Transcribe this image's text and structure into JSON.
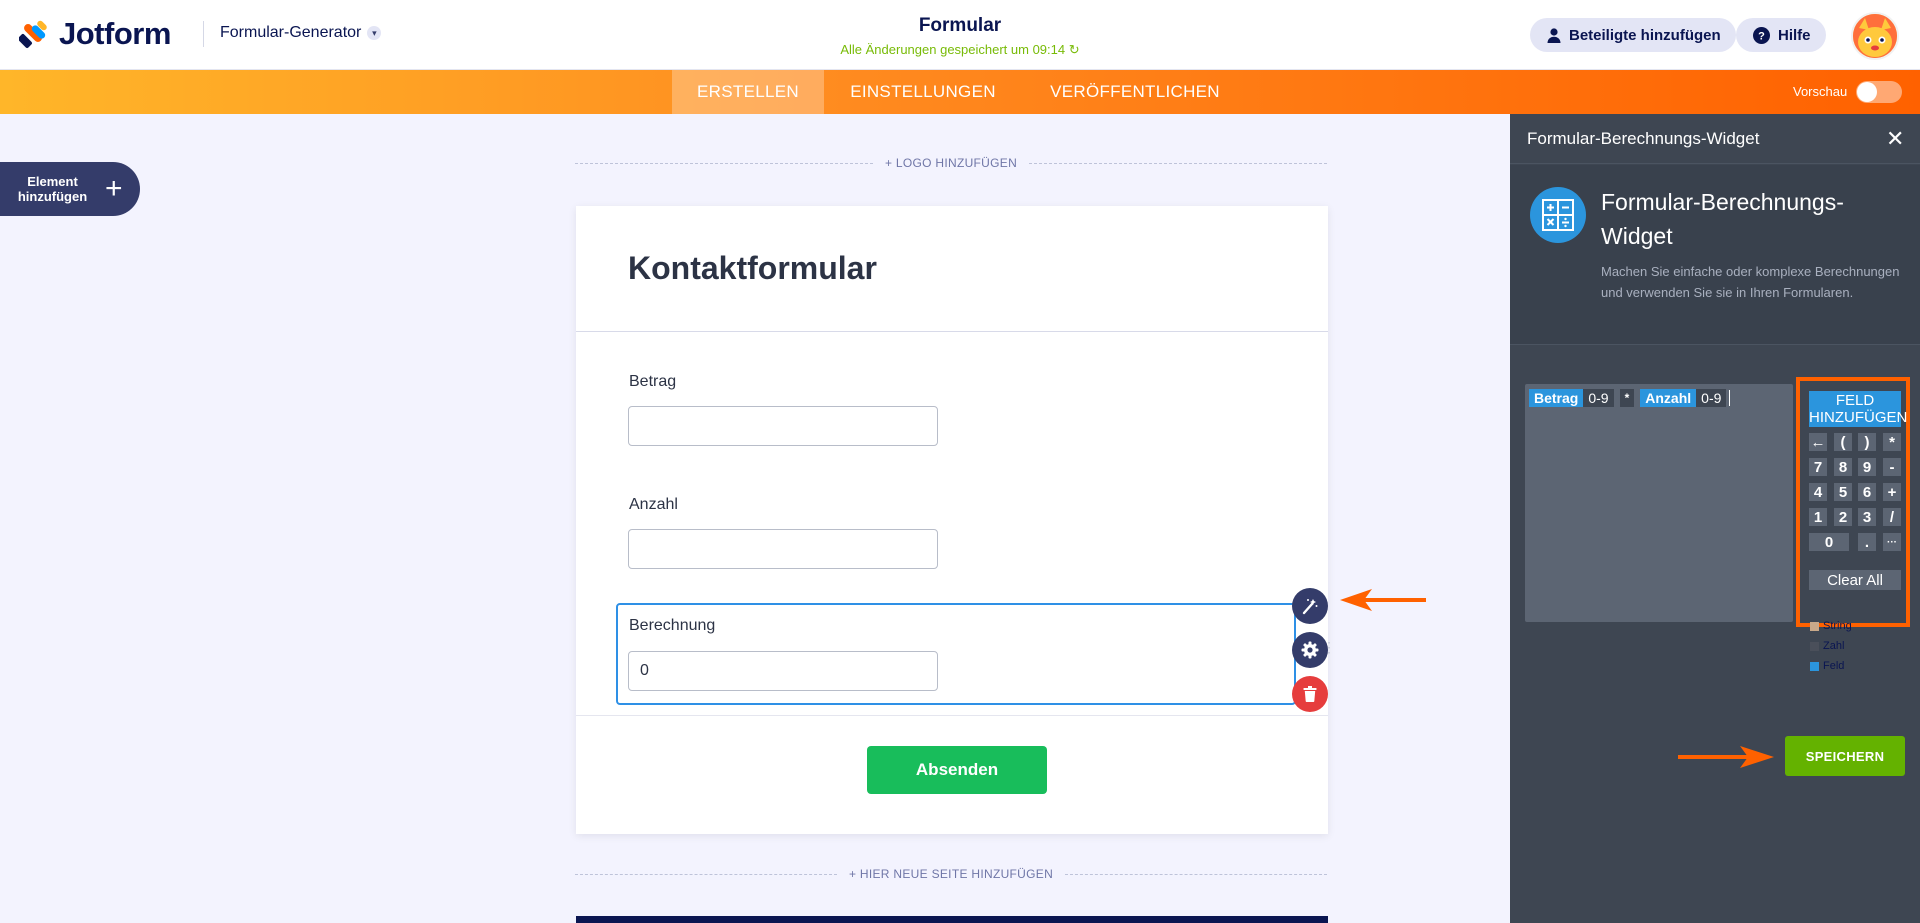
{
  "header": {
    "brand": "Jotform",
    "builder_menu": "Formular-Generator",
    "form_title": "Formular",
    "save_status": "Alle Änderungen gespeichert um 09:14",
    "participants_button": "Beteiligte hinzufügen",
    "help_button": "Hilfe"
  },
  "nav": {
    "tabs": [
      {
        "label": "ERSTELLEN",
        "active": true
      },
      {
        "label": "EINSTELLUNGEN",
        "active": false
      },
      {
        "label": "VERÖFFENTLICHEN",
        "active": false
      }
    ],
    "preview_label": "Vorschau",
    "preview_enabled": false
  },
  "builder": {
    "add_element_label": "Element hinzufügen",
    "add_logo": "+ LOGO HINZUFÜGEN",
    "add_page": "+ HIER NEUE SEITE HINZUFÜGEN"
  },
  "form": {
    "heading": "Kontaktformular",
    "fields": [
      {
        "label": "Betrag",
        "value": ""
      },
      {
        "label": "Anzahl",
        "value": ""
      },
      {
        "label": "Berechnung",
        "value": "0"
      }
    ],
    "submit_label": "Absenden"
  },
  "panel": {
    "title": "Formular-Berechnungs-Widget",
    "widget_name": "Formular-Berechnungs-Widget",
    "widget_description": "Machen Sie einfache oder komplexe Berechnungen und verwenden Sie sie in Ihren Formularen.",
    "formula_tokens": [
      {
        "type": "field",
        "text": "Betrag"
      },
      {
        "type": "range",
        "text": "0-9"
      },
      {
        "type": "op",
        "text": "*"
      },
      {
        "type": "field",
        "text": "Anzahl"
      },
      {
        "type": "range",
        "text": "0-9"
      }
    ],
    "add_field_button": "FELD HINZUFÜGEN",
    "keypad_rows": [
      [
        "←",
        "(",
        ")",
        "*"
      ],
      [
        "7",
        "8",
        "9",
        "-"
      ],
      [
        "4",
        "5",
        "6",
        "+"
      ],
      [
        "1",
        "2",
        "3",
        "/"
      ],
      [
        "0",
        ".",
        "···"
      ]
    ],
    "clear_all": "Clear All",
    "legend": [
      {
        "label": "String",
        "color": "#c9a98a"
      },
      {
        "label": "Zahl",
        "color": "#4a4f5a"
      },
      {
        "label": "Feld",
        "color": "#2b95dd"
      }
    ],
    "save_button": "SPEICHERN"
  },
  "colors": {
    "accent_orange": "#ff6100",
    "submit_green": "#18bd5b",
    "save_green": "#64b200",
    "field_blue": "#2b95dd",
    "panel_bg": "#3e4652"
  }
}
